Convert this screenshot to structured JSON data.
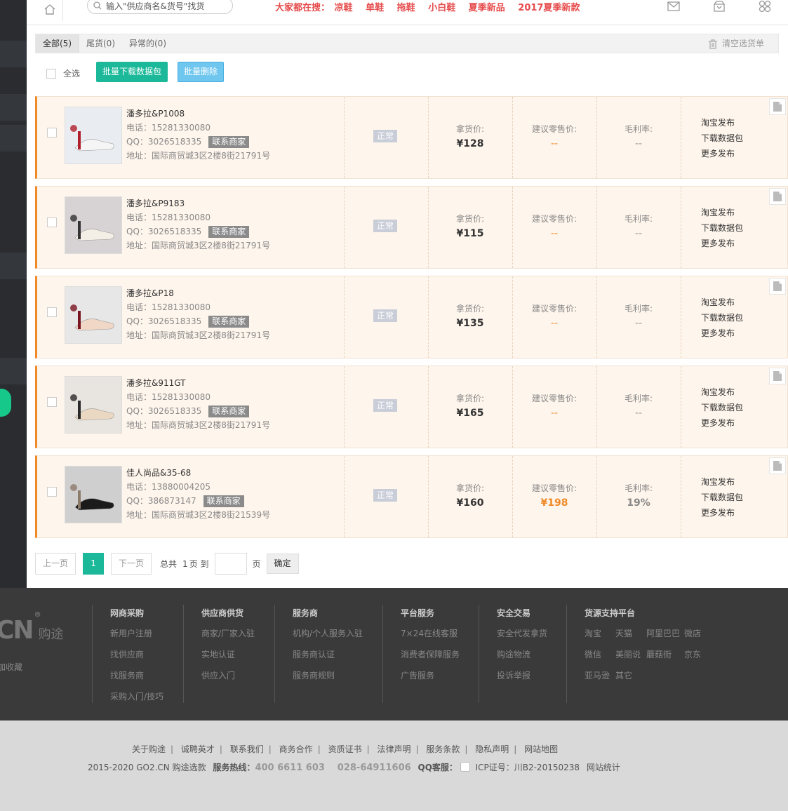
{
  "topbar": {
    "search_placeholder": "输入\"供应商名&货号\"找货",
    "hot_label": "大家都在搜：",
    "hot_items": [
      "凉鞋",
      "单鞋",
      "拖鞋",
      "小白鞋",
      "夏季新品",
      "2017夏季新款"
    ]
  },
  "tabs": {
    "all": "全部(5)",
    "tail": "尾货(0)",
    "abnormal": "异常的(0)",
    "clear": "清空选货单"
  },
  "toolbar": {
    "select_all": "全选",
    "batch_download": "批量下载数据包",
    "batch_delete": "批量删除"
  },
  "labels": {
    "contact": "联系商家",
    "status": "正常",
    "take_price": "拿货价:",
    "retail_price": "建议零售价:",
    "margin": "毛利率:",
    "act_taobao": "淘宝发布",
    "act_download": "下载数据包",
    "act_more": "更多发布"
  },
  "items": [
    {
      "title": "潘多拉&P1008",
      "phone": "电话：15281330080",
      "qq": "QQ：3026518335",
      "addr": "地址：国际商贸城3区2楼8街21791号",
      "price": "¥128",
      "retail": "--",
      "margin": "--"
    },
    {
      "title": "潘多拉&P9183",
      "phone": "电话：15281330080",
      "qq": "QQ：3026518335",
      "addr": "地址：国际商贸城3区2楼8街21791号",
      "price": "¥115",
      "retail": "--",
      "margin": "--"
    },
    {
      "title": "潘多拉&P18",
      "phone": "电话：15281330080",
      "qq": "QQ：3026518335",
      "addr": "地址：国际商贸城3区2楼8街21791号",
      "price": "¥135",
      "retail": "--",
      "margin": "--"
    },
    {
      "title": "潘多拉&911GT",
      "phone": "电话：15281330080",
      "qq": "QQ：3026518335",
      "addr": "地址：国际商贸城3区2楼8街21791号",
      "price": "¥165",
      "retail": "--",
      "margin": "--"
    },
    {
      "title": "佳人尚品&35-68",
      "phone": "电话：13880004205",
      "qq": "QQ：386873147",
      "addr": "地址：国际商贸城3区2楼8街21539号",
      "price": "¥160",
      "retail": "¥198",
      "margin": "19%"
    }
  ],
  "pager": {
    "prev": "上一页",
    "current": "1",
    "next": "下一页",
    "total": "总共",
    "total_num": "1",
    "page_to": "页 到",
    "page": "页",
    "ok": "确定"
  },
  "footer": {
    "brand": "CN",
    "brand_cn": "购途",
    "brand_mark": "®",
    "fav": "加收藏",
    "col1": {
      "title": "网商采购",
      "links": [
        "新用户注册",
        "找供应商",
        "找服务商",
        "采购入门/技巧"
      ]
    },
    "col2": {
      "title": "供应商供货",
      "links": [
        "商家/厂家入驻",
        "实地认证",
        "供应入门"
      ]
    },
    "col3": {
      "title": "服务商",
      "links": [
        "机构/个人服务入驻",
        "服务商认证",
        "服务商规则"
      ]
    },
    "col4": {
      "title": "平台服务",
      "links": [
        "7×24在线客服",
        "消费者保障服务",
        "广告服务"
      ]
    },
    "col5": {
      "title": "安全交易",
      "links": [
        "安全代发拿货",
        "购途物流",
        "投诉举报"
      ]
    },
    "col6": {
      "title": "货源支持平台",
      "links": [
        "淘宝",
        "天猫",
        "阿里巴巴",
        "微店",
        "微信",
        "美丽说",
        "蘑菇街",
        "京东",
        "亚马逊",
        "其它"
      ]
    }
  },
  "bottom": {
    "links": [
      "关于购途",
      "诚聘英才",
      "联系我们",
      "商务合作",
      "资质证书",
      "法律声明",
      "服务条款",
      "隐私声明",
      "网站地图"
    ],
    "copyright": "2015-2020 GO2.CN 购途选款",
    "hotline_label": "服务热线：",
    "hotline": "400 6611 603",
    "phone2": "028-64911606",
    "qq_label": "QQ客服：",
    "icp": "ICP证号：川B2-20150238",
    "stats": "网站统计"
  },
  "colors": {
    "accent_green": "#1bb999",
    "accent_orange": "#f08a28",
    "hot_red": "#e64b4b"
  }
}
